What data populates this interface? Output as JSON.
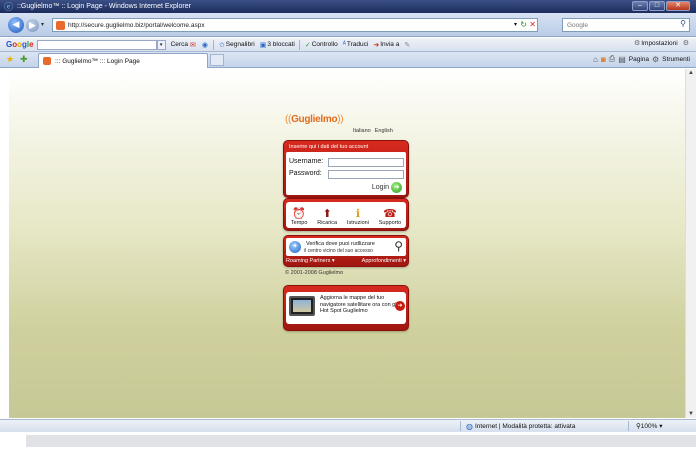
{
  "window": {
    "title": "::Guglielmo™ :: Login Page - Windows Internet Explorer",
    "buttons": {
      "minimize": "–",
      "maximize": "□",
      "close": "✕"
    }
  },
  "address_bar": {
    "url": "http://secure.guglielmo.biz/portal/welcome.aspx",
    "search_placeholder": "Google"
  },
  "google_toolbar": {
    "logo": [
      "G",
      "o",
      "o",
      "g",
      "l",
      "e"
    ],
    "items": {
      "search": "Cerca",
      "bookmarks": "Segnalibri",
      "blocked": "3 bloccati",
      "check": "Controllo",
      "translate": "Traduci",
      "send": "Invia a",
      "settings": "Impostazioni"
    }
  },
  "tab": {
    "title": "::: Guglielmo™ ::: Login Page"
  },
  "command_bar": {
    "page": "Pagina",
    "tools": "Strumenti"
  },
  "page": {
    "logo_text": "Guglielmo",
    "languages": [
      "Italiano",
      "English"
    ],
    "login": {
      "header": "Inserire qui i dati del tuo account",
      "username_label": "Username:",
      "password_label": "Password:",
      "button": "Login"
    },
    "menu": [
      {
        "label": "Tempo",
        "icon": "clock-icon",
        "glyph": "⏰"
      },
      {
        "label": "Ricarica",
        "icon": "recharge-icon",
        "glyph": "⬆"
      },
      {
        "label": "Istruzioni",
        "icon": "info-icon",
        "glyph": "ℹ"
      },
      {
        "label": "Supporto",
        "icon": "support-icon",
        "glyph": "☎"
      }
    ],
    "verify": {
      "line1": "Verifica dove puoi rudlizzare",
      "line2": "il centro vicino del suo accesso",
      "link_left": "Roaming Partners ▾",
      "link_right": "Approfondimenti ▾"
    },
    "copyright": "© 2001-2008 Guglielmo",
    "promo": {
      "text": "Aggiorna le mappe del tuo navigatore satellitare ora con gli Hot Spot Guglielmo"
    }
  },
  "status_bar": {
    "zone": "Internet | Modalità protetta: attivata",
    "zoom": "100%"
  },
  "colors": {
    "brand_red": "#d82a1f",
    "brand_orange": "#e36b1a",
    "ie_frame": "#1d2d5c"
  }
}
